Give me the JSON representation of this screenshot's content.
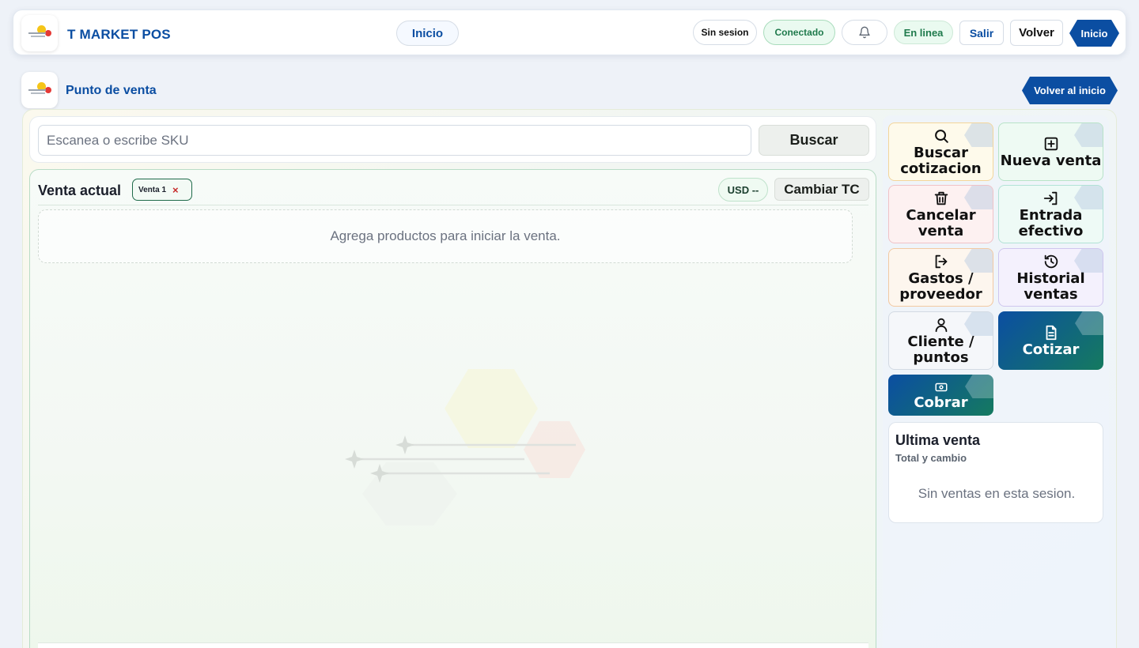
{
  "topbar": {
    "brand": "T MARKET POS",
    "nav_home": "Inicio",
    "session": "Sin sesion",
    "connected": "Conectado",
    "online": "En linea",
    "logout": "Salir",
    "back": "Volver",
    "home_hex": "Inicio"
  },
  "page": {
    "title": "Punto de venta",
    "back_home": "Volver al inicio"
  },
  "search": {
    "placeholder": "Escanea o escribe SKU",
    "value": "",
    "button": "Buscar"
  },
  "sale": {
    "title": "Venta actual",
    "tab_label": "Venta 1",
    "tab_close": "×",
    "currency": "USD --",
    "change_rate": "Cambiar TC",
    "empty_message": "Agrega productos para iniciar la venta."
  },
  "actions": [
    {
      "label": "Buscar cotizacion",
      "icon": "search-icon",
      "bg": "#fefaeb",
      "border": "#f3d59a"
    },
    {
      "label": "Nueva venta",
      "icon": "plus-square-icon",
      "bg": "#eefaf3",
      "border": "#b8e3c8"
    },
    {
      "label": "Cancelar venta",
      "icon": "trash-icon",
      "bg": "#fdf1f1",
      "border": "#f0c2c7"
    },
    {
      "label": "Entrada efectivo",
      "icon": "login-icon",
      "bg": "#eefaf6",
      "border": "#b2e2d6"
    },
    {
      "label": "Gastos / proveedor",
      "icon": "logout-icon",
      "bg": "#fdf6ee",
      "border": "#f2c9a2"
    },
    {
      "label": "Historial ventas",
      "icon": "history-icon",
      "bg": "#f4f1fd",
      "border": "#cfc6ee"
    },
    {
      "label": "Cliente / puntos",
      "icon": "user-icon",
      "bg": "#f5f7fa",
      "border": "#d3dae3"
    },
    {
      "label": "Cotizar",
      "icon": "document-icon",
      "bg": "dark",
      "border": "none"
    },
    {
      "label": "Cobrar",
      "icon": "cash-icon",
      "bg": "dark",
      "border": "none"
    }
  ],
  "last_sale": {
    "title": "Ultima venta",
    "subtitle": "Total y cambio",
    "empty": "Sin ventas en esta sesion."
  },
  "colors": {
    "brand_blue": "#0b4ea2",
    "accent_green": "#157a5f",
    "alert_red": "#c62828"
  }
}
